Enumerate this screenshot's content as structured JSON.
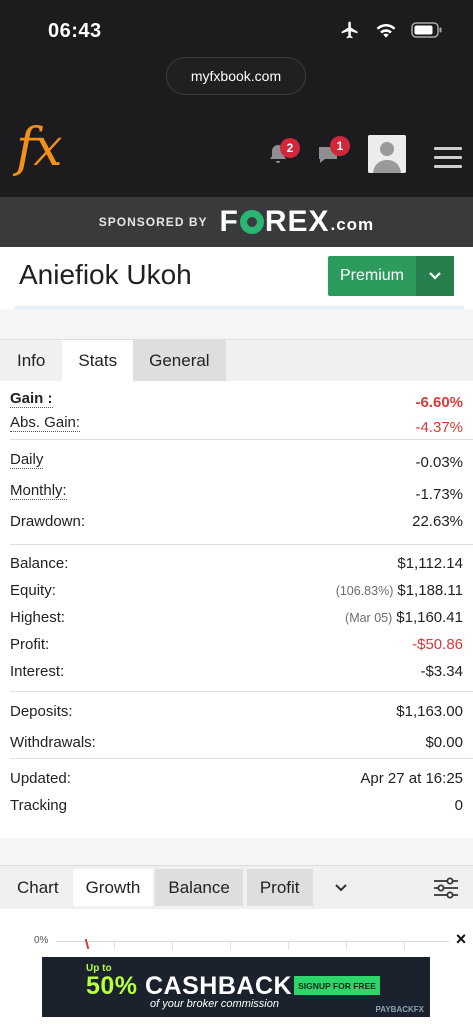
{
  "status_bar": {
    "time": "06:43",
    "url": "myfxbook.com"
  },
  "app_bar": {
    "logo": "fx",
    "notifications_count": "2",
    "messages_count": "1"
  },
  "sponsor": {
    "label": "SPONSORED BY",
    "brand_a": "F",
    "brand_b": "REX",
    "brand_suffix": ".com"
  },
  "header": {
    "name": "Aniefiok Ukoh",
    "premium_label": "Premium"
  },
  "tabs": [
    "Info",
    "Stats",
    "General"
  ],
  "stats": {
    "gain": {
      "label": "Gain :",
      "value": "-6.60%"
    },
    "abs_gain": {
      "label": "Abs. Gain:",
      "value": "-4.37%"
    },
    "daily": {
      "label": "Daily",
      "value": "-0.03%"
    },
    "monthly": {
      "label": "Monthly:",
      "value": "-1.73%"
    },
    "drawdown": {
      "label": "Drawdown:",
      "value": "22.63%"
    },
    "balance": {
      "label": "Balance:",
      "value": "$1,112.14"
    },
    "equity": {
      "label": "Equity:",
      "pre": "(106.83%)",
      "value": "$1,188.11"
    },
    "highest": {
      "label": "Highest:",
      "pre": "(Mar 05)",
      "value": "$1,160.41"
    },
    "profit": {
      "label": "Profit:",
      "value": "-$50.86"
    },
    "interest": {
      "label": "Interest:",
      "value": "-$3.34"
    },
    "deposits": {
      "label": "Deposits:",
      "value": "$1,163.00"
    },
    "withdrawals": {
      "label": "Withdrawals:",
      "value": "$0.00"
    },
    "updated": {
      "label": "Updated:",
      "value": "Apr 27 at 16:25"
    },
    "tracking": {
      "label": "Tracking",
      "value": "0"
    }
  },
  "chart_tabs": {
    "title": "Chart",
    "items": [
      "Growth",
      "Balance",
      "Profit"
    ]
  },
  "chart": {
    "y_label_zero": "0%"
  },
  "ad": {
    "upto": "Up to",
    "pct": "50%",
    "big": " CASHBACK",
    "sub": "of your broker commission",
    "cta": "SIGNUP FOR FREE",
    "brand": "PAYBACKFX",
    "close": "×"
  },
  "colors": {
    "accent_orange": "#f39019",
    "premium_green": "#2e9b5e",
    "negative_red": "#d63a3a",
    "badge_red": "#d2263a"
  }
}
